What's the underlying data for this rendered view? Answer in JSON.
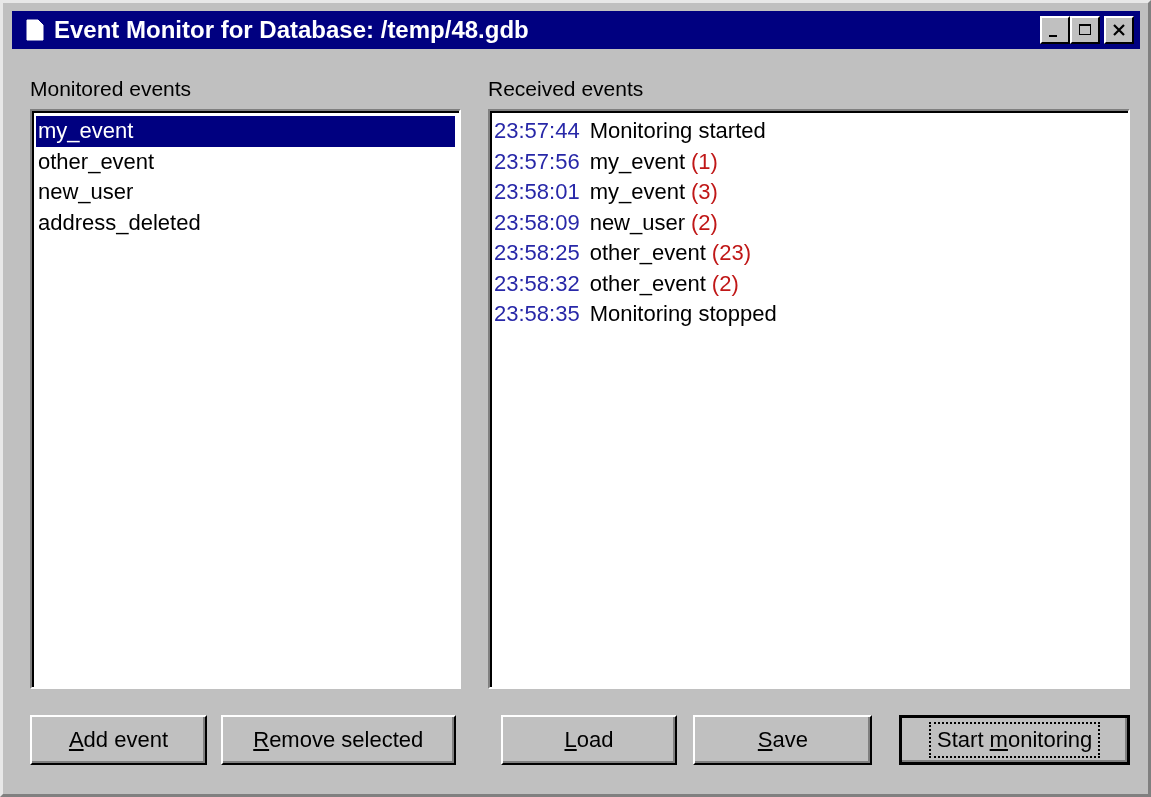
{
  "window": {
    "title": "Event Monitor for Database: /temp/48.gdb"
  },
  "monitored": {
    "label": "Monitored events",
    "items": [
      {
        "text": "my_event",
        "selected": true
      },
      {
        "text": "other_event",
        "selected": false
      },
      {
        "text": "new_user",
        "selected": false
      },
      {
        "text": "address_deleted",
        "selected": false
      }
    ]
  },
  "received": {
    "label": "Received events",
    "items": [
      {
        "time": "23:57:44",
        "text": "Monitoring started"
      },
      {
        "time": "23:57:56",
        "text": "my_event",
        "count": "(1)"
      },
      {
        "time": "23:58:01",
        "text": "my_event",
        "count": "(3)"
      },
      {
        "time": "23:58:09",
        "text": "new_user",
        "count": "(2)"
      },
      {
        "time": "23:58:25",
        "text": "other_event",
        "count": "(23)"
      },
      {
        "time": "23:58:32",
        "text": "other_event",
        "count": "(2)"
      },
      {
        "time": "23:58:35",
        "text": "Monitoring stopped"
      }
    ]
  },
  "buttons": [
    {
      "key": "A",
      "after": "dd event",
      "default": false
    },
    {
      "key": "R",
      "after": "emove selected",
      "default": false
    },
    {
      "key": "L",
      "after": "oad",
      "default": false
    },
    {
      "key": "S",
      "after": "ave",
      "default": false
    },
    {
      "before": "Start ",
      "key": "m",
      "after": "onitoring",
      "default": true
    }
  ]
}
